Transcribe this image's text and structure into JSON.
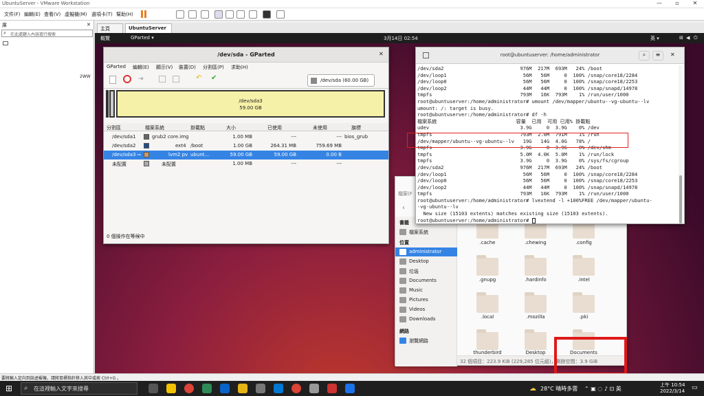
{
  "app": {
    "title": "UbuntuServer - VMware Workstation"
  },
  "menu": [
    "文件(F)",
    "編輯(E)",
    "查看(V)",
    "虛擬機(M)",
    "選項卡(T)",
    "幫助(H)"
  ],
  "library": {
    "title": "庫",
    "search_placeholder": "在此處鍵入內容進行搜索",
    "vm_label": "2WW"
  },
  "tabs": {
    "home": "主頁",
    "vm": "UbuntuServer"
  },
  "guest_top": {
    "activities": "概覽",
    "app": "GParted ▾",
    "clock": "3月14日  02:54",
    "lang": "英 ▾"
  },
  "gparted": {
    "title": "/dev/sda - GParted",
    "menu": [
      "GParted",
      "編輯(E)",
      "顯示(V)",
      "裝置(D)",
      "分割區(P)",
      "求助(H)"
    ],
    "device": "/dev/sda (60.00 GB)",
    "graph_label": "/dev/sda3",
    "graph_size": "59.00 GB",
    "columns": [
      "分割區",
      "檔案系統",
      "掛載點",
      "大小",
      "已使用",
      "未使用",
      "旗標"
    ],
    "rows": [
      {
        "part": "/dev/sda1",
        "fs": "grub2 core.img",
        "mount": "",
        "size": "1.00 MB",
        "used": "---",
        "unused": "---",
        "flags": "bios_grub",
        "color": "#666666"
      },
      {
        "part": "/dev/sda2",
        "fs": "ext4",
        "mount": "/boot",
        "size": "1.00 GB",
        "used": "264.31 MB",
        "unused": "759.69 MB",
        "flags": "",
        "color": "#1f4e8c"
      },
      {
        "part": "/dev/sda3",
        "fs": "lvm2 pv",
        "mount": "ubunt...",
        "size": "59.00 GB",
        "used": "59.00 GB",
        "unused": "0.00 B",
        "flags": "",
        "color": "#c89a6a"
      },
      {
        "part": "未配置",
        "fs": "未配置",
        "mount": "",
        "size": "1.00 MB",
        "used": "---",
        "unused": "---",
        "flags": "",
        "color": "#aaaaaa"
      }
    ],
    "status": "0 個操作在等候中"
  },
  "terminal": {
    "title": "root@ubuntuserver: /home/administrator",
    "lines": [
      "/dev/sda2                          976M  217M  693M   24% /boot",
      "/dev/loop1                          56M   56M     0  100% /snap/core18/2284",
      "/dev/loop0                          56M   56M     0  100% /snap/core18/2253",
      "/dev/loop2                          44M   44M     0  100% /snap/snapd/14978",
      "tmpfs                              793M   16K  793M    1% /run/user/1000",
      "root@ubuntuserver:/home/administrator# umount /dev/mapper/ubuntu--vg-ubuntu--lv",
      "umount: /: target is busy.",
      "root@ubuntuserver:/home/administrator# df -h",
      "檔案系統                           容量  已用  可用 已用% 掛載點",
      "udev                               3.9G     0  3.9G    0% /dev",
      "tmpfs                              793M  2.0M  791M    1% /run",
      "/dev/mapper/ubuntu--vg-ubuntu--lv   19G   14G  4.0G   78% /",
      "tmpfs                              3.9G     0  3.9G    0% /dev/shm",
      "tmpfs                              5.0M  4.0K  5.0M    1% /run/lock",
      "tmpfs                              3.9G     0  3.9G    0% /sys/fs/cgroup",
      "/dev/sda2                          976M  217M  693M   24% /boot",
      "/dev/loop1                          56M   56M     0  100% /snap/core18/2284",
      "/dev/loop0                          56M   56M     0  100% /snap/core18/2253",
      "/dev/loop2                          44M   44M     0  100% /snap/snapd/14978",
      "tmpfs                              793M   16K  793M    1% /run/user/1000",
      "root@ubuntuserver:/home/administrator# lvextend -l +100%FREE /dev/mapper/ubuntu-",
      "-vg-ubuntu--lv",
      "  New size (15103 extents) matches existing size (15103 extents).",
      "root@ubuntuserver:/home/administrator# "
    ]
  },
  "files": {
    "sidebar": {
      "bookmarks_label": "書籤",
      "bookmark": "檔案系統",
      "places_label": "位置",
      "network_label": "網路",
      "browse": "瀏覽網路",
      "places": [
        "administrator",
        "Desktop",
        "垃圾",
        "Documents",
        "Music",
        "Pictures",
        "Videos",
        "Downloads"
      ]
    },
    "folders": [
      ".cache",
      ".chewing",
      ".config",
      ".gnupg",
      ".hardinfo",
      ".intel",
      ".local",
      ".mozilla",
      ".pki",
      "thunderbird",
      "Desktop",
      "Documents"
    ],
    "status": "32 個項目：223.9 KiB (229,285 位元組)，剩餘空間：3.9 GiB",
    "partial_label": "檔案(F"
  },
  "vm_status": "要將輸入定向到該虛擬機，請將鼠標指針移入其中或按 Ctrl+G 。",
  "taskbar": {
    "search": "在這裡輸入文字來搜尋",
    "weather": "28°C  晴時多雲",
    "time": "上午 10:54",
    "date": "2022/3/14"
  },
  "colors": {
    "ubuntu_bg": "#8b1e3f",
    "highlight": "#3584e4",
    "annotation": "#e01818"
  }
}
